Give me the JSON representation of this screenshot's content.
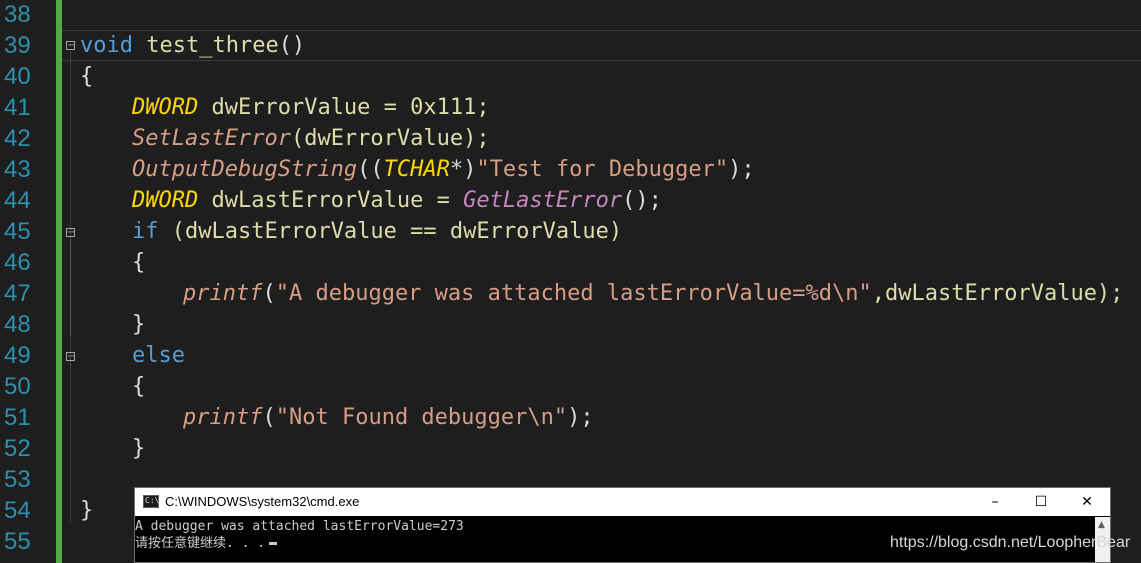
{
  "editor": {
    "line_numbers": [
      "38",
      "39",
      "40",
      "41",
      "42",
      "43",
      "44",
      "45",
      "46",
      "47",
      "48",
      "49",
      "50",
      "51",
      "52",
      "53",
      "54",
      "55"
    ],
    "code": {
      "l39": {
        "kw": "void",
        "name": "test_three",
        "paren": "()"
      },
      "l40": {
        "brace": "{"
      },
      "l41": {
        "type": "DWORD",
        "rest": " dwErrorValue = 0x111;"
      },
      "l42": {
        "fn": "SetLastError",
        "rest": "(dwErrorValue);"
      },
      "l43": {
        "fn": "OutputDebugString",
        "p1": "((",
        "type": "TCHAR",
        "p2": "*)",
        "str": "\"Test for Debugger\"",
        "end": ");"
      },
      "l44": {
        "type": "DWORD",
        "mid": " dwLastErrorValue = ",
        "fn": "GetLastError",
        "end": "();"
      },
      "l45": {
        "kw": "if",
        "rest": " (dwLastErrorValue == dwErrorValue)"
      },
      "l46": {
        "brace": "{"
      },
      "l47": {
        "fn": "printf",
        "p1": "(",
        "str": "\"A debugger was attached lastErrorValue=%d\\n\"",
        "rest": ",dwLastErrorValue);"
      },
      "l48": {
        "brace": "}"
      },
      "l49": {
        "kw": "else"
      },
      "l50": {
        "brace": "{"
      },
      "l51": {
        "fn": "printf",
        "p1": "(",
        "str": "\"Not Found debugger\\n\"",
        "end": ");"
      },
      "l52": {
        "brace": "}"
      },
      "l54": {
        "brace": "}"
      }
    },
    "fold_minus": "−",
    "colors": {
      "keyword": "#569cd6",
      "function": "#d69d85",
      "type": "#ffd700",
      "string": "#d69d85",
      "line_number": "#2b91af",
      "change_bar": "#57a64a",
      "background": "#1e1e1e"
    }
  },
  "console": {
    "title": "C:\\WINDOWS\\system32\\cmd.exe",
    "icon_text": "C:\\",
    "minimize_icon": "–",
    "maximize_icon": "☐",
    "close_icon": "✕",
    "scroll_up_icon": "▲",
    "lines": [
      "A debugger was attached lastErrorValue=273",
      "请按任意键继续. . ."
    ]
  },
  "watermark": "https://blog.csdn.net/LoopherBear"
}
